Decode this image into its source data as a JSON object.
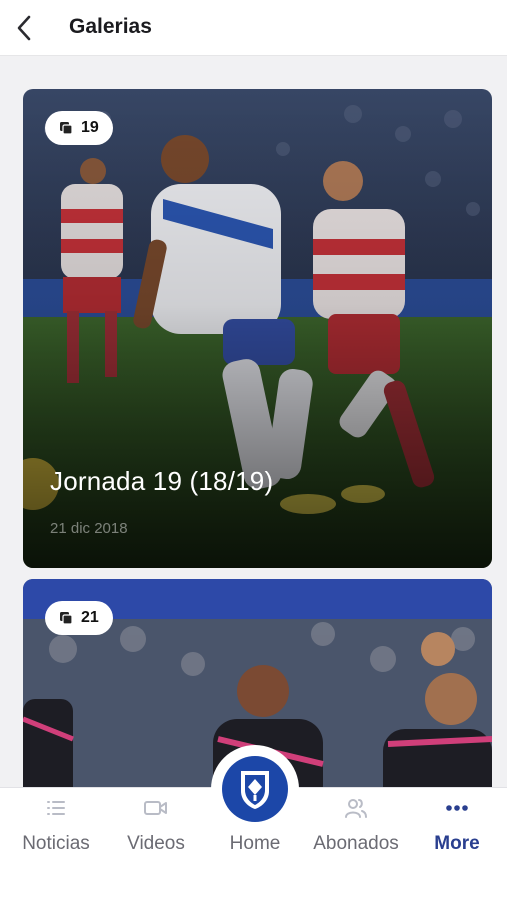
{
  "header": {
    "title": "Galerias",
    "back_icon": "chevron-left-icon"
  },
  "galleries": [
    {
      "photo_count": "19",
      "title": "Jornada 19 (18/19)",
      "date": "21 dic 2018"
    },
    {
      "photo_count": "21"
    }
  ],
  "bottom_nav": {
    "items": [
      {
        "label": "Noticias",
        "icon": "news-list-icon"
      },
      {
        "label": "Videos",
        "icon": "video-camera-icon"
      },
      {
        "label": "Home",
        "icon": "club-crest-icon"
      },
      {
        "label": "Abonados",
        "icon": "users-icon"
      },
      {
        "label": "More",
        "icon": "more-dots-icon"
      }
    ],
    "active": "More"
  },
  "colors": {
    "accent": "#2a3f8f",
    "home_crest_bg": "#1c47a8",
    "inactive_text": "#6b6b73"
  }
}
